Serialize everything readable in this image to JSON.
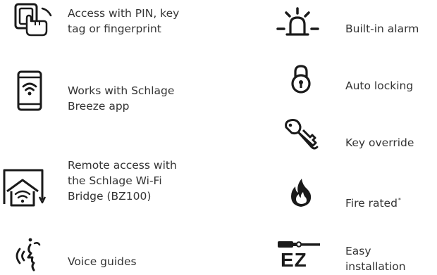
{
  "features_left": [
    {
      "id": "pin",
      "icon": "touch-keypad-icon",
      "lines": [
        "Access with PIN, key",
        "tag or fingerprint"
      ]
    },
    {
      "id": "app",
      "icon": "phone-wifi-icon",
      "lines": [
        "Works with Schlage",
        "Breeze app"
      ]
    },
    {
      "id": "remote",
      "icon": "wifi-bridge-icon",
      "lines": [
        "Remote access with",
        "the Schlage Wi-Fi",
        "Bridge (BZ100)"
      ]
    },
    {
      "id": "voice",
      "icon": "voice-icon",
      "lines": [
        "Voice guides"
      ]
    }
  ],
  "features_right": [
    {
      "id": "alarm",
      "icon": "alarm-icon",
      "lines": [
        "Built-in alarm"
      ]
    },
    {
      "id": "locking",
      "icon": "padlock-icon",
      "lines": [
        "Auto locking"
      ]
    },
    {
      "id": "override",
      "icon": "key-icon",
      "lines": [
        "Key override"
      ]
    },
    {
      "id": "fire",
      "icon": "flame-icon",
      "text": "Fire rated",
      "sup": "*"
    },
    {
      "id": "install",
      "icon": "screwdriver-icon",
      "badge": "EZ",
      "lines": [
        "Easy",
        "installation"
      ]
    }
  ],
  "colors": {
    "icon": "#1a1a1a",
    "text": "#333333"
  }
}
